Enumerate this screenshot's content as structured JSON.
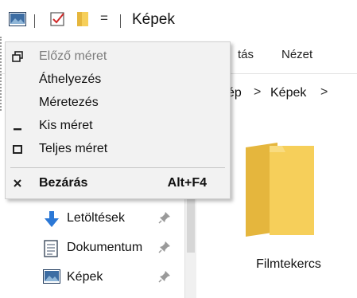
{
  "titlebar": {
    "title": "Képek",
    "quick_access_dropdown": "="
  },
  "ribbon": {
    "tabs": [
      {
        "id": "view-partial",
        "label": "tás"
      },
      {
        "id": "view",
        "label": "Nézet"
      }
    ]
  },
  "address": {
    "breadcrumbs": [
      "ép",
      "Képek"
    ],
    "separator": ">"
  },
  "system_menu": {
    "items": [
      {
        "id": "restore",
        "label": "Előző méret",
        "enabled": false,
        "icon": "restore-icon"
      },
      {
        "id": "move",
        "label": "Áthelyezés",
        "enabled": true,
        "icon": ""
      },
      {
        "id": "size",
        "label": "Méretezés",
        "enabled": true,
        "icon": ""
      },
      {
        "id": "minimize",
        "label": "Kis méret",
        "enabled": true,
        "icon": "minimize-icon"
      },
      {
        "id": "maximize",
        "label": "Teljes méret",
        "enabled": true,
        "icon": "maximize-icon"
      },
      {
        "id": "close",
        "label": "Bezárás",
        "enabled": true,
        "bold": true,
        "icon": "close-icon",
        "shortcut": "Alt+F4"
      }
    ]
  },
  "navigation": {
    "items": [
      {
        "label": "Letöltések",
        "icon": "download-arrow-icon",
        "pinned": true
      },
      {
        "label": "Dokumentum",
        "icon": "document-icon",
        "pinned": true
      },
      {
        "label": "Képek",
        "icon": "pictures-icon",
        "pinned": true
      }
    ]
  },
  "content": {
    "items": [
      {
        "label": "Filmtekercs",
        "icon": "folder-icon"
      }
    ]
  },
  "colors": {
    "folder_yellow": "#f6cf5a",
    "folder_dark": "#e5b63d",
    "download_blue": "#2b78d6",
    "menu_bg": "#f2f2f2"
  }
}
